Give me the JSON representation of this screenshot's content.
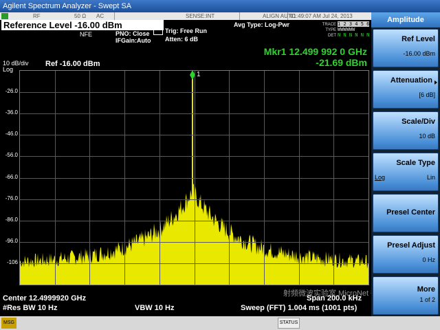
{
  "app": {
    "title": "Agilent Spectrum Analyzer - Swept SA"
  },
  "status_strip": {
    "rf": "RF",
    "impedance": "50 Ω",
    "coupling": "AC",
    "sense": "SENSE:INT",
    "align": "ALIGN AUTO",
    "datetime": "01:49:07 AM Jul 24, 2013"
  },
  "header": {
    "reference_level": "Reference Level -16.00 dBm",
    "nfe": "NFE",
    "pno": "PNO: Close",
    "ifgain": "IFGain:Auto",
    "trig": "Trig: Free Run",
    "atten": "Atten: 6 dB",
    "avg_type": "Avg Type: Log-Pwr",
    "trace_rows": [
      {
        "label": "TRACE",
        "cells": "1 2 3 4 5 6"
      },
      {
        "label": "TYPE",
        "cells": "WWWWWW"
      },
      {
        "label": "DET",
        "cells": "N N N N N N"
      }
    ]
  },
  "plot": {
    "scale": "10 dB/div",
    "scale_type": "Log",
    "ref": "Ref -16.00 dBm",
    "marker_line1": "Mkr1 12.499 992 0 GHz",
    "marker_line2": "-21.69 dBm",
    "marker_id": "1",
    "y_ticks": [
      "-26.0",
      "-36.0",
      "-46.0",
      "-56.0",
      "-66.0",
      "-76.0",
      "-86.0",
      "-96.0",
      "-106"
    ],
    "trace_color": "#e8e800",
    "marker_color": "#2ed42e"
  },
  "footer": {
    "center": "Center 12.4999920 GHz",
    "res_bw": "#Res BW 10 Hz",
    "vbw": "VBW 10 Hz",
    "span": "Span 200.0 kHz",
    "sweep": "Sweep (FFT) 1.004 ms (1001 pts)"
  },
  "bottombar": {
    "msg": "MSG",
    "status": "STATUS"
  },
  "softkeys": {
    "title": "Amplitude",
    "items": [
      {
        "label": "Ref Level",
        "value": "-16.00 dBm"
      },
      {
        "label": "Attenuation",
        "value": "[6 dB]"
      },
      {
        "label": "Scale/Div",
        "value": "10 dB"
      },
      {
        "label": "Scale Type",
        "left": "Log",
        "value": "Lin"
      },
      {
        "label": "Presel Center",
        "value": ""
      },
      {
        "label": "Presel Adjust",
        "value": "0 Hz"
      },
      {
        "label": "More",
        "value": "1 of 2"
      }
    ]
  },
  "watermark": "射频微波实验室 MicroNet 微网"
}
